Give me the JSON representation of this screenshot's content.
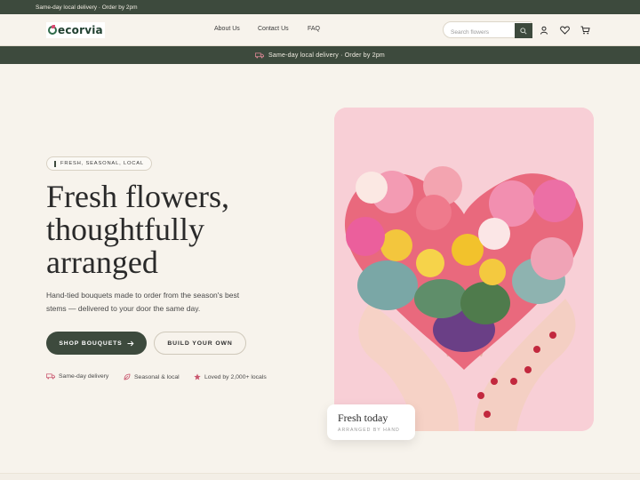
{
  "topbar": {
    "text": "Same-day local delivery · Order by 2pm"
  },
  "header": {
    "logo_text": "ecorvia",
    "nav": [
      "About Us",
      "Contact Us",
      "FAQ"
    ],
    "search": {
      "placeholder": "Search flowers",
      "value": ""
    }
  },
  "promo": {
    "text": "Same-day local delivery · Order by 2pm"
  },
  "hero": {
    "pill": "FRESH, SEASONAL, LOCAL",
    "headline": [
      "Fresh flowers,",
      "thoughtfully",
      "arranged"
    ],
    "subtext": "Hand-tied bouquets made to order from the season's best stems — delivered to your door the same day.",
    "primary_cta": "SHOP BOUQUETS",
    "secondary_cta": "BUILD YOUR OWN",
    "features": [
      "Same-day delivery",
      "Seasonal & local",
      "Loved by 2,000+ locals"
    ]
  },
  "card": {
    "title": "Fresh today",
    "subtitle": "ARRANGED BY HAND"
  },
  "colors": {
    "brand": "#3d4a3d",
    "background": "#f7f3ec",
    "accent_pink": "#f8cfd6",
    "heart": "#d94a72"
  }
}
